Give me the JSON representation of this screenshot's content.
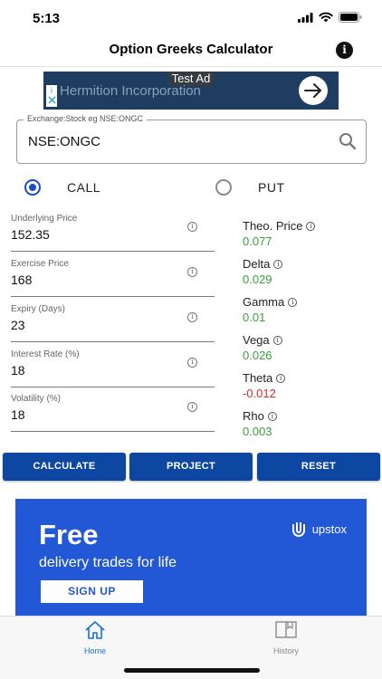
{
  "status_bar": {
    "time": "5:13",
    "icons": [
      "signal-icon",
      "wifi-icon",
      "battery-icon"
    ]
  },
  "nav": {
    "title": "Option Greeks Calculator",
    "info_icon": "i"
  },
  "ad": {
    "label": "Test Ad",
    "company": "Hermition Incorporation",
    "adchoice_icon": "i"
  },
  "search": {
    "legend": "Exchange:Stock eg NSE:ONGC",
    "value": "NSE:ONGC"
  },
  "option_type": {
    "options": [
      {
        "label": "CALL",
        "selected": true
      },
      {
        "label": "PUT",
        "selected": false
      }
    ]
  },
  "inputs": [
    {
      "label": "Underlying Price",
      "value": "152.35"
    },
    {
      "label": "Exercise Price",
      "value": "168"
    },
    {
      "label": "Expiry (Days)",
      "value": "23"
    },
    {
      "label": "Interest Rate (%)",
      "value": "18"
    },
    {
      "label": "Volatility (%)",
      "value": "18"
    }
  ],
  "info_glyph": "i",
  "greeks": [
    {
      "label": "Theo. Price",
      "value": "0.077",
      "color": "#3aa03a"
    },
    {
      "label": "Delta",
      "value": "0.029",
      "color": "#3aa03a"
    },
    {
      "label": "Gamma",
      "value": "0.01",
      "color": "#3aa03a"
    },
    {
      "label": "Vega",
      "value": "0.026",
      "color": "#3aa03a"
    },
    {
      "label": "Theta",
      "value": "-0.012",
      "color": "#d0302a"
    },
    {
      "label": "Rho",
      "value": "0.003",
      "color": "#3aa03a"
    }
  ],
  "buttons": {
    "calculate": "CALCULATE",
    "project": "PROJECT",
    "reset": "RESET"
  },
  "promo": {
    "headline": "Free",
    "subtext": "delivery trades for life",
    "brand": "upstox",
    "cta": "SIGN UP"
  },
  "tabs": [
    {
      "label": "Home",
      "active": true,
      "color": "#1a6dd6"
    },
    {
      "label": "History",
      "active": false,
      "color": "#8a8a8a"
    }
  ],
  "colors": {
    "accent": "#0d47a1",
    "promo_bg": "#2258d6",
    "radio_selected": "#1a4fc4"
  }
}
